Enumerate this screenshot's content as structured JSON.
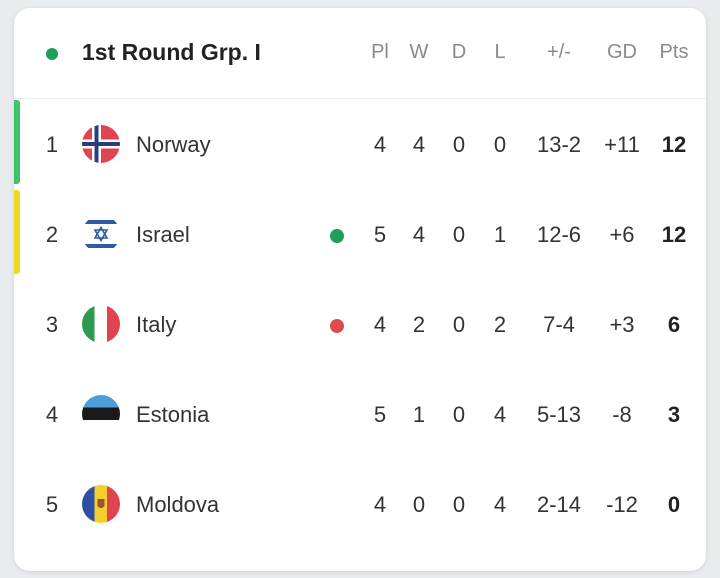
{
  "header": {
    "title": "1st Round Grp. I",
    "columns": {
      "pl": "Pl",
      "w": "W",
      "d": "D",
      "l": "L",
      "score": "+/-",
      "gd": "GD",
      "pts": "Pts"
    }
  },
  "colors": {
    "live_dot": "#1e9e5a",
    "qualify_bar": "#3ec46d",
    "playoff_bar": "#f2d729",
    "form_win": "#1e9e5a",
    "form_loss": "#e04b4b"
  },
  "rows": [
    {
      "rank": "1",
      "team": "Norway",
      "flag_icon": "norway-flag-icon",
      "bar": "qualify",
      "form": "",
      "pl": "4",
      "w": "4",
      "d": "0",
      "l": "0",
      "score": "13-2",
      "gd": "+11",
      "pts": "12"
    },
    {
      "rank": "2",
      "team": "Israel",
      "flag_icon": "israel-flag-icon",
      "bar": "playoff",
      "form": "win",
      "pl": "5",
      "w": "4",
      "d": "0",
      "l": "1",
      "score": "12-6",
      "gd": "+6",
      "pts": "12"
    },
    {
      "rank": "3",
      "team": "Italy",
      "flag_icon": "italy-flag-icon",
      "bar": "",
      "form": "loss",
      "pl": "4",
      "w": "2",
      "d": "0",
      "l": "2",
      "score": "7-4",
      "gd": "+3",
      "pts": "6"
    },
    {
      "rank": "4",
      "team": "Estonia",
      "flag_icon": "estonia-flag-icon",
      "bar": "",
      "form": "",
      "pl": "5",
      "w": "1",
      "d": "0",
      "l": "4",
      "score": "5-13",
      "gd": "-8",
      "pts": "3"
    },
    {
      "rank": "5",
      "team": "Moldova",
      "flag_icon": "moldova-flag-icon",
      "bar": "",
      "form": "",
      "pl": "4",
      "w": "0",
      "d": "0",
      "l": "4",
      "score": "2-14",
      "gd": "-12",
      "pts": "0"
    }
  ]
}
